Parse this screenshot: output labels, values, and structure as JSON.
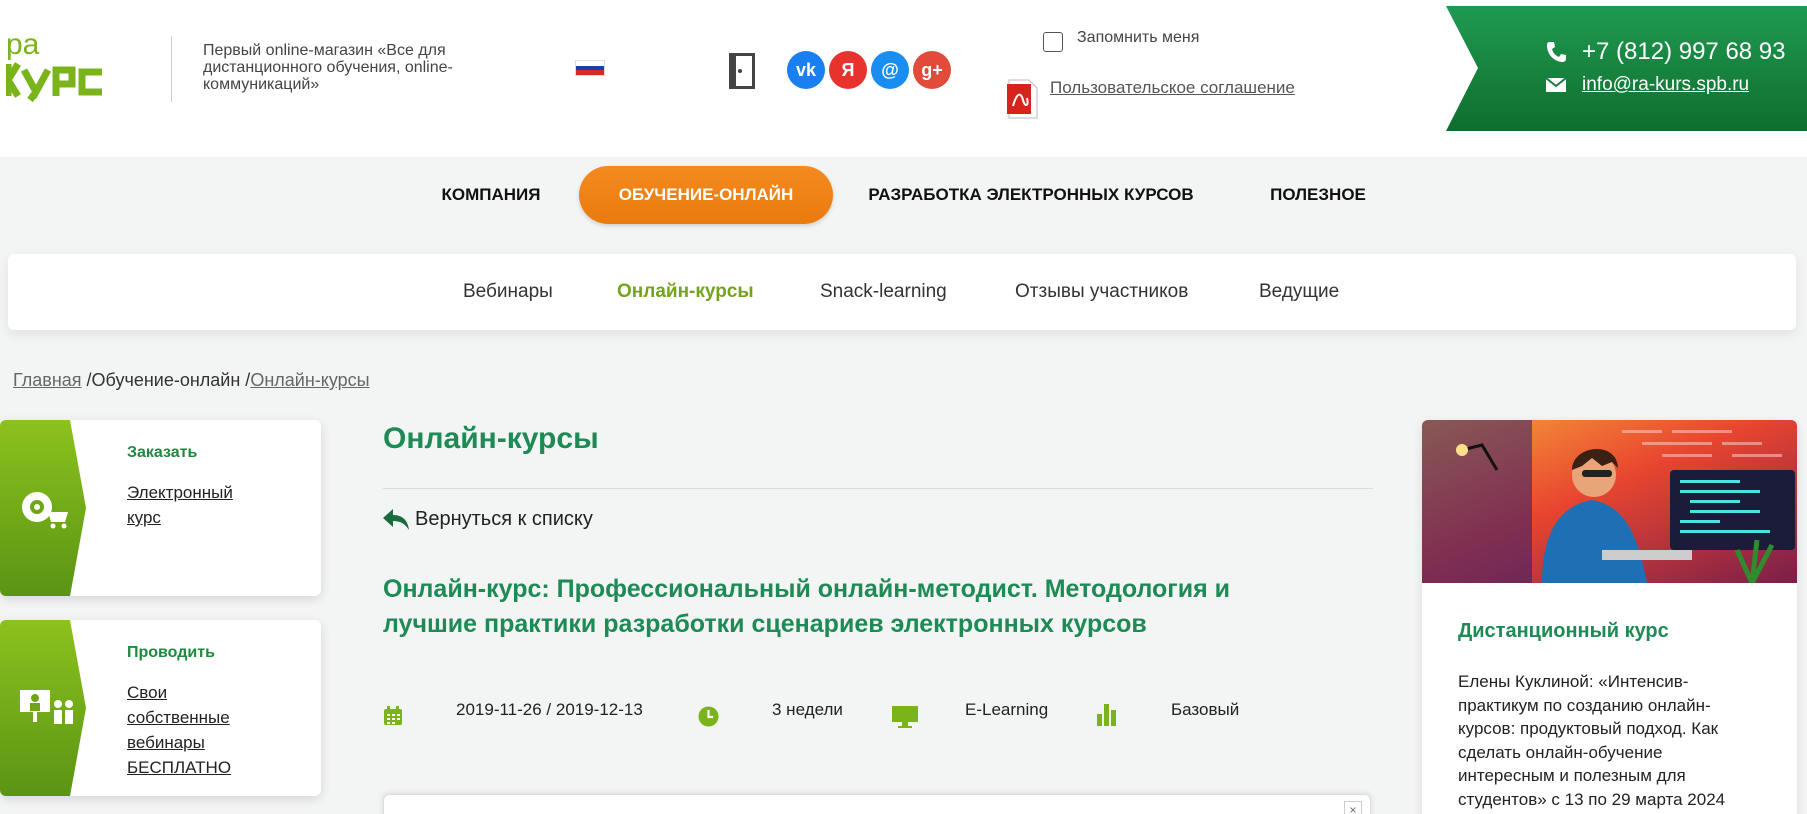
{
  "header": {
    "tagline": "Первый online-магазин «Все для дистанционного обучения, online-коммуникаций»",
    "remember_label": "Запомнить меня",
    "agreement_link": "Пользовательское соглашение",
    "phone": "+7 (812) 997 68 93",
    "email": "info@ra-kurs.spb.ru",
    "social": [
      {
        "icon": "vk-icon",
        "glyph": "vk",
        "color": "#1a7ff0"
      },
      {
        "icon": "yandex-icon",
        "glyph": "Я",
        "color": "#e8322d"
      },
      {
        "icon": "mailru-icon",
        "glyph": "@",
        "color": "#1a8ef0"
      },
      {
        "icon": "google-plus-icon",
        "glyph": "g+",
        "color": "#e04b3a"
      }
    ]
  },
  "main_nav": {
    "items": [
      "КОМПАНИЯ",
      "ОБУЧЕНИЕ-ОНЛАЙН",
      "РАЗРАБОТКА ЭЛЕКТРОННЫХ КУРСОВ",
      "ПОЛЕЗНОЕ"
    ],
    "active": "ОБУЧЕНИЕ-ОНЛАЙН"
  },
  "sub_nav": {
    "items": [
      "Вебинары",
      "Онлайн-курсы",
      "Snack-learning",
      "Отзывы участников",
      "Ведущие"
    ],
    "active": "Онлайн-курсы"
  },
  "breadcrumb": {
    "home": "Главная",
    "sep1": " /",
    "section": "Обучение-онлайн",
    "sep2": " /",
    "current": "Онлайн-курсы"
  },
  "sidebar": {
    "order_card": {
      "title": "Заказать",
      "link": "Электронный курс"
    },
    "host_card": {
      "title": "Проводить",
      "link": "Свои собственные вебинары БЕСПЛАТНО"
    }
  },
  "content": {
    "page_title": "Онлайн-курсы",
    "back_link": "Вернуться к списку",
    "course_title": "Онлайн-курс: Профессиональный онлайн-методист. Методология и лучшие практики разработки сценариев электронных курсов",
    "dates": "2019-11-26 / 2019-12-13",
    "duration": "3 недели",
    "format": "E-Learning",
    "level": "Базовый",
    "panel_close": "×"
  },
  "promo": {
    "title": "Дистанционный курс",
    "text": "Елены Куклиной: «Интенсив-практикум по созданию онлайн-курсов: продуктовый подход. Как сделать онлайн-обучение интересным и полезным для студентов» с 13 по 29 марта 2024"
  },
  "colors": {
    "brand_green": "#1e8a55",
    "accent_green": "#74a41c",
    "orange": "#f48a1f"
  }
}
